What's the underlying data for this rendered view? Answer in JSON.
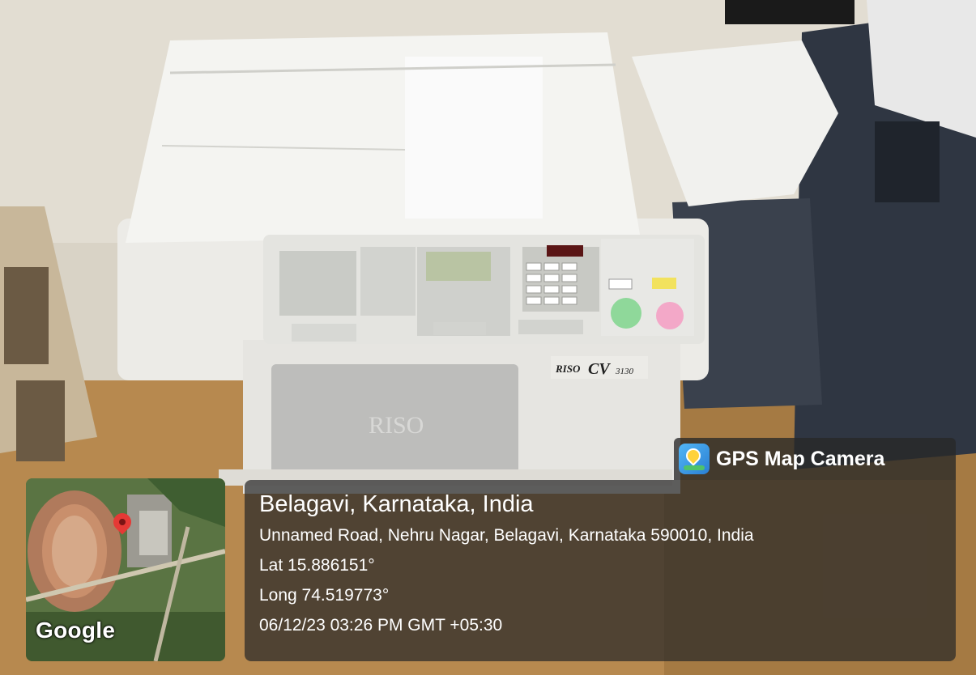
{
  "overlay": {
    "app_name": "GPS Map Camera",
    "place": "Belagavi, Karnataka, India",
    "address": "Unnamed Road, Nehru Nagar, Belagavi, Karnataka 590010, India",
    "latitude": "Lat 15.886151°",
    "longitude": "Long 74.519773°",
    "timestamp": "06/12/23 03:26 PM GMT +05:30",
    "map_logo": "Google",
    "icons": [
      "gps-map-camera-app-icon",
      "map-pin-icon"
    ]
  },
  "photo": {
    "subject": "RISO CV3130 digital duplicator on a table",
    "machine_brand": "RISO",
    "machine_model": "3130",
    "front_logo": "RISO"
  },
  "colors": {
    "overlay_bg": "#282828",
    "overlay_text": "#ffffff",
    "pin": "#e53935",
    "start_button": "#8fd89a",
    "stop_button": "#f3a8c8"
  }
}
